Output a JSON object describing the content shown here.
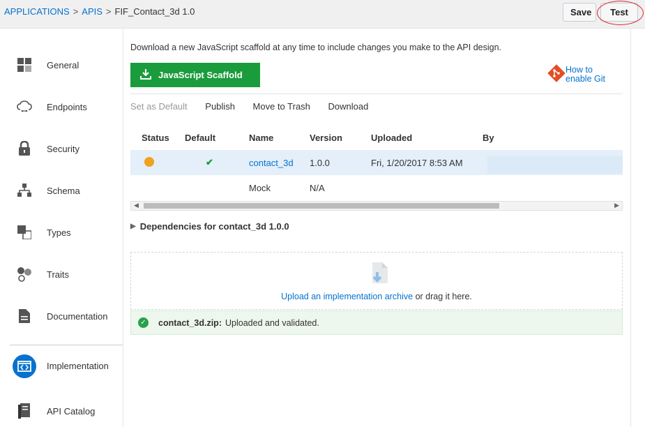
{
  "breadcrumb": {
    "apps": "APPLICATIONS",
    "sep1": ">",
    "apis": "APIS",
    "sep2": ">",
    "current": "FIF_Contact_3d  1.0"
  },
  "header": {
    "save_label": "Save",
    "test_label": "Test"
  },
  "sidebar": {
    "items": [
      {
        "label": "General",
        "icon": "grid-icon"
      },
      {
        "label": "Endpoints",
        "icon": "cloud-icon"
      },
      {
        "label": "Security",
        "icon": "lock-icon"
      },
      {
        "label": "Schema",
        "icon": "hierarchy-icon"
      },
      {
        "label": "Types",
        "icon": "types-icon"
      },
      {
        "label": "Traits",
        "icon": "traits-icon"
      },
      {
        "label": "Documentation",
        "icon": "document-icon"
      },
      {
        "label": "Implementation",
        "icon": "code-icon",
        "active": true
      },
      {
        "label": "API Catalog",
        "icon": "catalog-icon"
      }
    ]
  },
  "main": {
    "intro": "Download a new JavaScript scaffold at any time to include changes you make to the API design.",
    "scaffold_label": "JavaScript Scaffold",
    "git_line1": "How to",
    "git_line2": "enable Git",
    "toolbar": {
      "set_default": "Set as Default",
      "publish": "Publish",
      "move_trash": "Move to Trash",
      "download": "Download"
    },
    "table": {
      "headers": {
        "status": "Status",
        "default": "Default",
        "name": "Name",
        "version": "Version",
        "uploaded": "Uploaded",
        "by": "By"
      },
      "rows": [
        {
          "name": "contact_3d",
          "version": "1.0.0",
          "uploaded": "Fri, 1/20/2017 8:53 AM",
          "default_mark": "✔"
        },
        {
          "name": "Mock",
          "version": "N/A",
          "uploaded": ""
        }
      ]
    },
    "dependencies": "Dependencies for contact_3d 1.0.0",
    "upload": {
      "link": "Upload an implementation archive",
      "rest": " or drag it here."
    },
    "success": {
      "file": "contact_3d.zip:",
      "message": "Uploaded and validated."
    }
  },
  "colors": {
    "accent": "#0572ce",
    "scaffold_green": "#1a9c3c",
    "status_orange": "#f0a21b",
    "selected_row": "#e4effa"
  }
}
